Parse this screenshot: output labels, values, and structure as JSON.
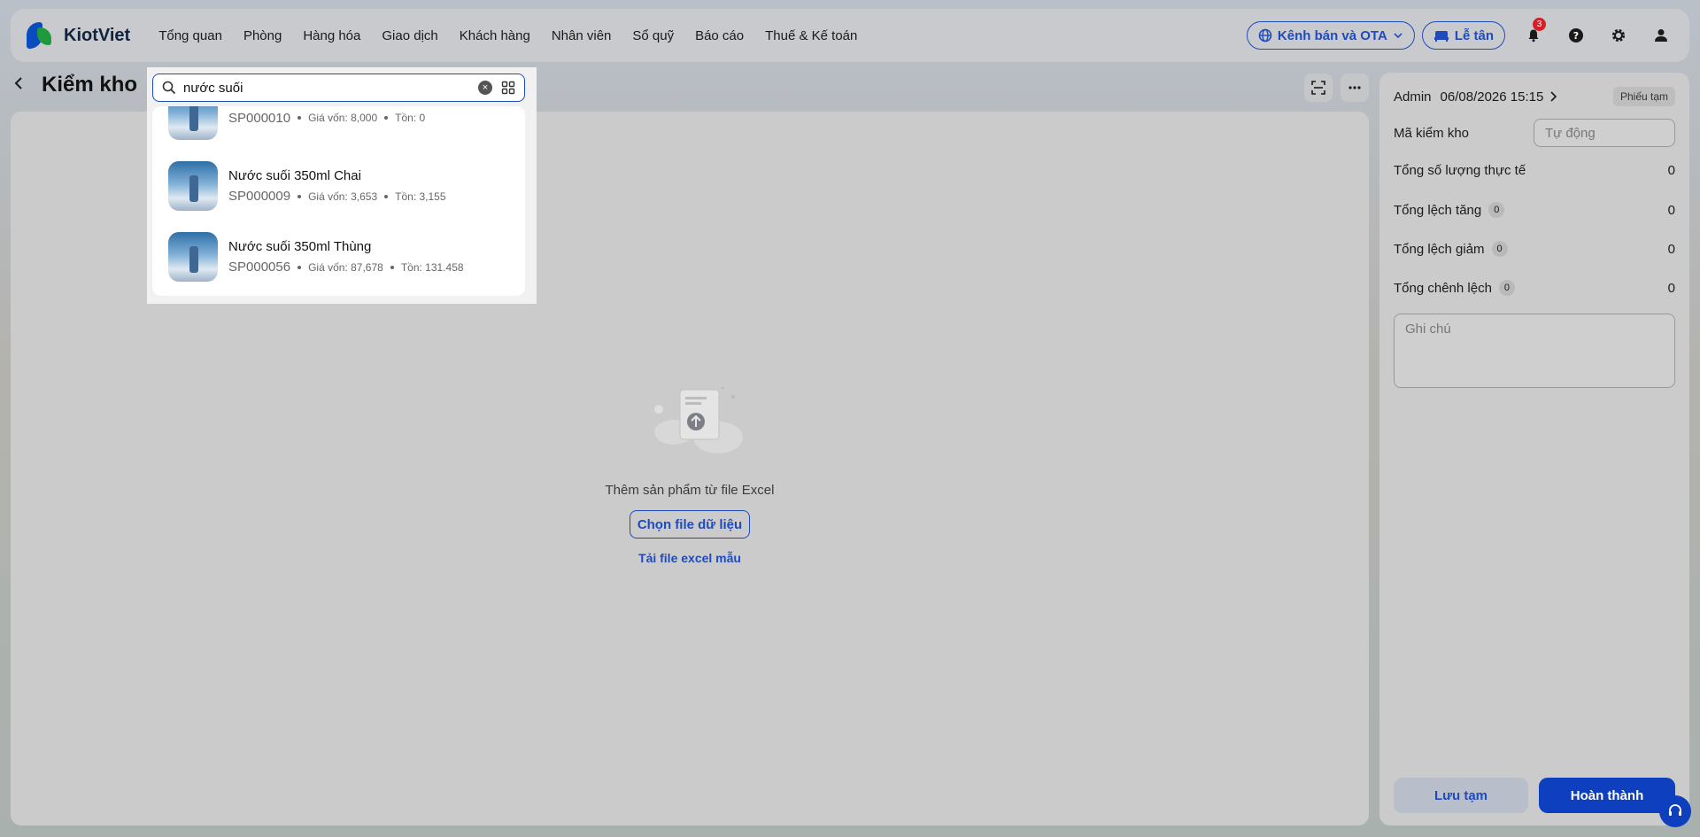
{
  "nav": {
    "logo_text": "KiotViet",
    "menu": [
      "Tổng quan",
      "Phòng",
      "Hàng hóa",
      "Giao dịch",
      "Khách hàng",
      "Nhân viên",
      "Sổ quỹ",
      "Báo cáo",
      "Thuế & Kế toán"
    ],
    "channel_label": "Kênh bán và OTA",
    "reception_label": "Lễ tân",
    "notification_count": "3",
    "accent_color": "#1f4bbd"
  },
  "page": {
    "title": "Kiểm kho"
  },
  "search": {
    "value": "nước suối",
    "results": [
      {
        "name": "",
        "code": "SP000010",
        "cost": "Giá vốn: 8,000",
        "stock": "Tồn: 0"
      },
      {
        "name": "Nước suối 350ml Chai",
        "code": "SP000009",
        "cost": "Giá vốn: 3,653",
        "stock": "Tồn: 3,155"
      },
      {
        "name": "Nước suối 350ml Thùng",
        "code": "SP000056",
        "cost": "Giá vốn: 87,678",
        "stock": "Tồn: 131.458"
      }
    ]
  },
  "empty": {
    "message": "Thêm sản phẩm từ file Excel",
    "choose_button": "Chọn file dữ liệu",
    "template_link": "Tải file excel mẫu"
  },
  "side": {
    "user": "Admin",
    "datetime": "06/08/2026 15:15",
    "status_tag": "Phiếu tạm",
    "code_label": "Mã kiểm kho",
    "code_placeholder": "Tự động",
    "total_actual_label": "Tổng số lượng thực tế",
    "total_actual_value": "0",
    "increase_label": "Tổng lệch tăng",
    "increase_count": "0",
    "increase_value": "0",
    "decrease_label": "Tổng lệch giảm",
    "decrease_count": "0",
    "decrease_value": "0",
    "diff_label": "Tổng chênh lệch",
    "diff_count": "0",
    "diff_value": "0",
    "note_placeholder": "Ghi chú",
    "save_label": "Lưu tạm",
    "done_label": "Hoàn thành"
  }
}
